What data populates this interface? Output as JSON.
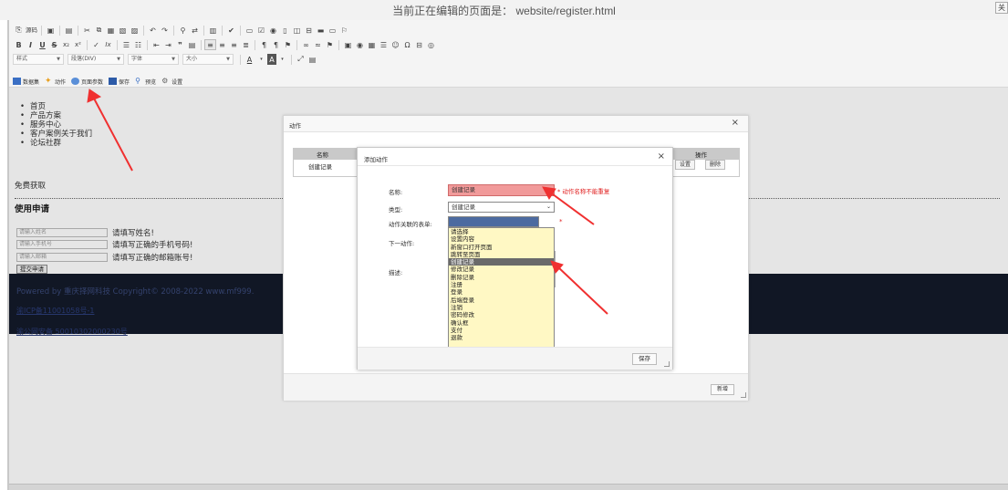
{
  "topbar": {
    "title": "当前正在编辑的页面是： website/register.html",
    "close_label": "关闭"
  },
  "toolbar": {
    "row1_icons": [
      "source-icon",
      "save-doc-icon",
      "template-icon",
      "cut-icon",
      "copy-icon",
      "paste-icon",
      "paste-text-icon",
      "paste-word-icon",
      "undo-icon",
      "redo-icon",
      "find-icon",
      "replace-icon",
      "select-all-icon",
      "spellcheck-icon",
      "form-icon",
      "radio-icon",
      "textfield-icon",
      "textarea-icon",
      "select-icon",
      "button-icon",
      "image-button-icon",
      "hidden-field-icon"
    ],
    "row1_source_label": "源码",
    "row2_icons": [
      "bold-icon",
      "italic-icon",
      "underline-icon",
      "strike-icon",
      "subscript-icon",
      "superscript-icon",
      "clear-format-icon",
      "numbered-list-icon",
      "bullet-list-icon",
      "outdent-icon",
      "indent-icon",
      "blockquote-icon",
      "div-icon",
      "align-left-icon",
      "align-center-icon",
      "align-right-icon",
      "justify-icon",
      "ltr-icon",
      "rtl-icon",
      "language-icon",
      "link-icon",
      "unlink-icon",
      "anchor-icon",
      "image-icon",
      "flash-icon",
      "table-icon",
      "hr-icon",
      "smiley-icon",
      "special-char-icon",
      "pagebreak-icon",
      "iframe-icon"
    ],
    "row2_glyphs": [
      "B",
      "I",
      "U",
      "S",
      "x₂",
      "x²",
      "✓",
      "Ix"
    ],
    "row3": {
      "style_label": "样式",
      "format_label": "段落(DIV)",
      "font_label": "字体",
      "size_label": "大小",
      "text_color_glyph": "A",
      "bg_color_glyph": "A"
    },
    "row4": [
      {
        "icon": "dataset-icon",
        "label": "数据集"
      },
      {
        "icon": "action-icon",
        "label": "动作"
      },
      {
        "icon": "page-params-icon",
        "label": "页面参数"
      },
      {
        "icon": "save-icon",
        "label": "保存"
      },
      {
        "icon": "preview-icon",
        "label": "预览"
      },
      {
        "icon": "settings-icon",
        "label": "设置"
      }
    ]
  },
  "page": {
    "nav": [
      "首页",
      "产品方案",
      "服务中心",
      "客户案例关于我们",
      "论坛社群"
    ],
    "free_get": "免费获取",
    "use_title": "使用申请",
    "form": [
      {
        "placeholder": "请输入姓名",
        "hint": "请填写姓名!"
      },
      {
        "placeholder": "请输入手机号",
        "hint": "请填写正确的手机号码!"
      },
      {
        "placeholder": "请输入邮箱",
        "hint": "请填写正确的邮箱账号!"
      }
    ],
    "submit_label": "提交申请",
    "footer_line1": "Powered by 重庆择网科技 Copyright© 2008-2022 www.mf999.",
    "footer_line2": "渝ICP备11001058号-1",
    "footer_line3": "渝公网安备 50010302000230号"
  },
  "action_dialog": {
    "title": "动作",
    "close": "×",
    "grid_headers": [
      "名称",
      "操作"
    ],
    "grid_row_name": "创建记录",
    "grid_row_buttons": [
      "设置",
      "删除"
    ],
    "add_button": "新增"
  },
  "add_dialog": {
    "title": "添加动作",
    "close": "×",
    "labels": {
      "name": "名称:",
      "type": "类型:",
      "form": "动作关联的表单:",
      "next": "下一动作:",
      "desc": "描述:"
    },
    "name_value": "创建记录",
    "name_error": "* 动作名称不能重复",
    "type_value": "创建记录",
    "form_required": "*",
    "type_options": [
      "请选择",
      "设置内容",
      "新窗口打开页面",
      "跳转至页面",
      "创建记录",
      "修改记录",
      "删除记录",
      "注册",
      "登录",
      "后端登录",
      "注销",
      "密码修改",
      "确认框",
      "支付",
      "退款"
    ],
    "selected_option_index": 4,
    "save_label": "保存"
  },
  "colors": {
    "name_error_bg": "#f19a9a",
    "error_text": "#e02020",
    "dropdown_bg": "#fff8c4",
    "dropdown_selected": "#6a6a6a",
    "footer_bg": "#141a2a",
    "arrow": "#f03030"
  }
}
